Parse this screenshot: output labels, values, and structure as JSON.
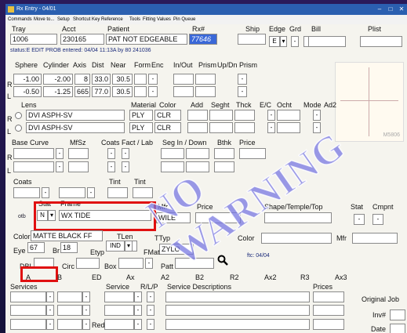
{
  "window": {
    "title": "Rx Entry - 04/01"
  },
  "menu": [
    "Commands",
    "Move to...",
    "Setup",
    "Shortcut Key Reference",
    "Tools",
    "Fitting Values",
    "Pin Queue"
  ],
  "header": {
    "labels": {
      "tray": "Tray",
      "acct": "Acct",
      "patient": "Patient",
      "rx": "Rx#",
      "ship": "Ship",
      "edge": "Edge",
      "grd": "Grd",
      "bill": "Bill",
      "plist": "Plist"
    },
    "tray": "1006",
    "acct": "230165",
    "patient": "PAT NOT EDGEABLE",
    "rx": "77646",
    "edge": "E"
  },
  "status_line": "status:E EDIT PROB   entered: 04/04 11:13A by 80  241036",
  "rx_table": {
    "headers": [
      "Sphere",
      "Cylinder",
      "Axis",
      "Dist",
      "Near",
      "Form",
      "Enc",
      "In/Out",
      "Prism",
      "Up/Dn",
      "Prism"
    ],
    "right": {
      "eye": "R",
      "sphere": "-1.00",
      "cylinder": "-2.00",
      "axis": "8",
      "dist": "33.0",
      "near": "30.5"
    },
    "left": {
      "eye": "L",
      "sphere": "-0.50",
      "cylinder": "-1.25",
      "axis": "665",
      "dist": "77.0",
      "near": "30.5"
    }
  },
  "lens": {
    "headers": {
      "lens": "Lens",
      "material": "Material",
      "color": "Color",
      "add": "Add",
      "seght": "Seght",
      "thck": "Thck",
      "ec": "E/C",
      "ocht": "Ocht",
      "mode": "Mode",
      "ad2": "Ad2"
    },
    "right": {
      "eye": "R",
      "name": "DVI ASPH-SV",
      "material": "PLY",
      "color": "CLR"
    },
    "left": {
      "eye": "L",
      "name": "DVI ASPH-SV",
      "material": "PLY",
      "color": "CLR"
    }
  },
  "base_curve": {
    "headers": {
      "base_curve": "Base Curve",
      "mfsz": "MfSz",
      "coats_fact": "Coats Fact / Lab",
      "seg": "Seg In / Down",
      "bthk": "Bthk",
      "price": "Price"
    },
    "eyes": [
      "R",
      "L"
    ]
  },
  "coats": {
    "headers": {
      "coats": "Coats",
      "tint1": "Tint",
      "tint2": "Tint"
    }
  },
  "frame": {
    "headers": {
      "stat": "Stat",
      "frame": "Frame",
      "mfr": "Mfr",
      "price": "Price",
      "shape": "Shape/Temple/Top",
      "stat2": "Stat",
      "cmpnt": "Cmpnt"
    },
    "otb": "otb",
    "stat": "N",
    "name": "WX TIDE",
    "mfr_value": "WILE",
    "color_label": "Color",
    "color_value": "MATTE BLACK FF",
    "tlen_label": "TLen",
    "ttyp_label": "TTyp",
    "ttyp_value": "ZYLO",
    "color2_label": "Color",
    "mfr2_label": "Mfr",
    "eye_label": "Eye",
    "eye_value": "67",
    "br_label": "Br",
    "br_value": "18",
    "etyp_label": "Etyp",
    "etyp_value": "IND",
    "fmat_label": "FMat",
    "dbl_label": "DBL",
    "circ_label": "Circ",
    "box_label": "Box",
    "patt_label": "Patt",
    "ftc_text": "ftc: 04/04"
  },
  "measurements": {
    "labels": [
      "A",
      "B",
      "ED",
      "Ax",
      "A2",
      "B2",
      "R2",
      "Ax2",
      "R3",
      "Ax3"
    ]
  },
  "services": {
    "headers": {
      "services": "Services",
      "service": "Service",
      "rlp": "R/L/P",
      "desc": "Service Descriptions",
      "prices": "Prices"
    },
    "original_job": "Original Job",
    "inv": "Inv#",
    "date": "Date",
    "redo": "Redo"
  },
  "stamp": "NO WARNING",
  "thumb_label": "M5806",
  "colors": {
    "titlebar": "#2b5fb0",
    "highlight": "#3a68d8",
    "red": "#e01010",
    "status_text": "#1a2a7a"
  }
}
